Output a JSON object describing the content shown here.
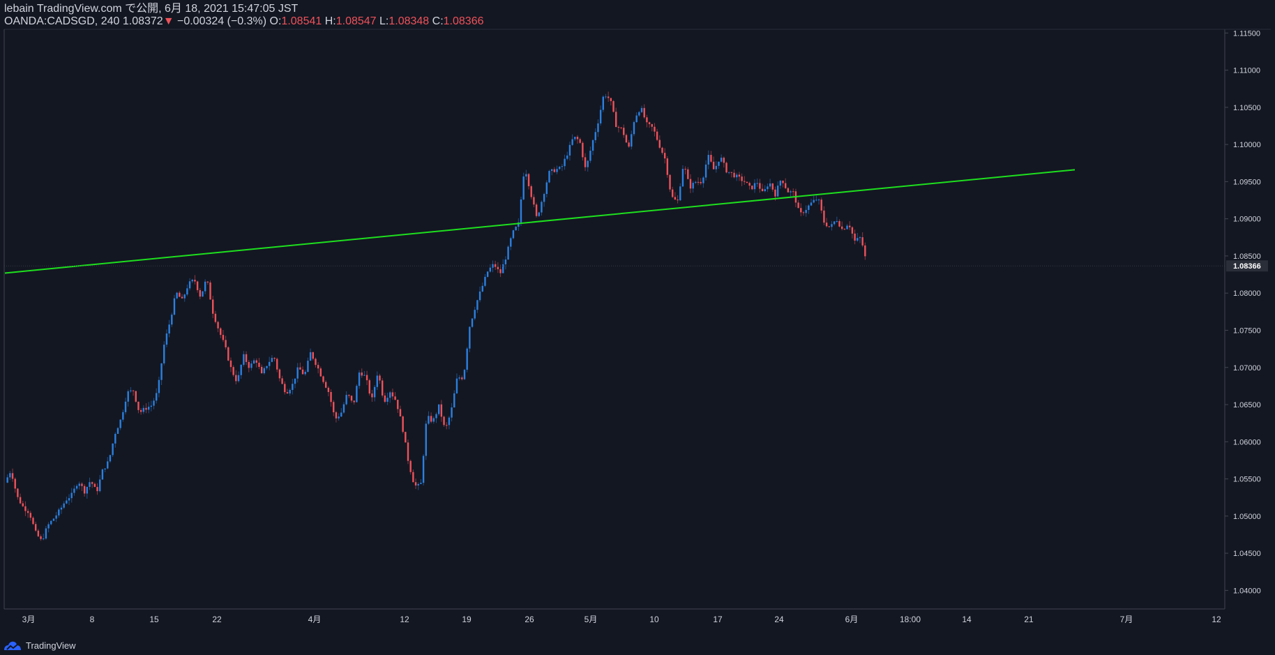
{
  "header": {
    "published_line": "lebain TradingView.com で公開, 6月 18, 2021 15:47:05 JST",
    "symbol": "OANDA:CADSGD, 240",
    "last": "1.08372",
    "change_arrow": "▼",
    "change": "−0.00324 (−0.3%)",
    "o_label": "O:",
    "o_value": "1.08541",
    "h_label": "H:",
    "h_value": "1.08547",
    "l_label": "L:",
    "l_value": "1.08348",
    "c_label": "C:",
    "c_value": "1.08366"
  },
  "footer": {
    "brand": "TradingView"
  },
  "colors": {
    "background": "#131722",
    "up": "#2b80e0",
    "down": "#f0525a",
    "trendline": "#1ee01e",
    "axis_text": "#d1d4dc"
  },
  "chart_data": {
    "type": "candlestick",
    "symbol": "OANDA:CADSGD",
    "timeframe": "240",
    "ylim": [
      1.0375,
      1.1155
    ],
    "y_ticks": [
      "1.11500",
      "1.11000",
      "1.10500",
      "1.10000",
      "1.09500",
      "1.09000",
      "1.08500",
      "1.08000",
      "1.07500",
      "1.07000",
      "1.06500",
      "1.06000",
      "1.05500",
      "1.05000",
      "1.04500",
      "1.04000"
    ],
    "x_ticks": [
      "3月",
      "8",
      "15",
      "22",
      "4月",
      "12",
      "19",
      "26",
      "5月",
      "10",
      "17",
      "24",
      "6月",
      "18:00",
      "14",
      "21",
      "7月",
      "12"
    ],
    "last_price_label": "1.08366",
    "trendline": {
      "start": [
        0,
        1.0827
      ],
      "end": [
        175,
        1.0966
      ]
    },
    "path_points": [
      [
        0,
        1.0545
      ],
      [
        1,
        1.0562
      ],
      [
        2,
        1.0526
      ],
      [
        3,
        1.0512
      ],
      [
        4,
        1.0505
      ],
      [
        5,
        1.0478
      ],
      [
        6,
        1.0466
      ],
      [
        7,
        1.0487
      ],
      [
        8,
        1.0497
      ],
      [
        9,
        1.0508
      ],
      [
        10,
        1.0522
      ],
      [
        11,
        1.0529
      ],
      [
        12,
        1.0548
      ],
      [
        13,
        1.0533
      ],
      [
        14,
        1.0548
      ],
      [
        15,
        1.0532
      ],
      [
        16,
        1.0562
      ],
      [
        17,
        1.0574
      ],
      [
        18,
        1.0611
      ],
      [
        19,
        1.0631
      ],
      [
        20,
        1.0666
      ],
      [
        21,
        1.0669
      ],
      [
        22,
        1.0639
      ],
      [
        23,
        1.0645
      ],
      [
        24,
        1.0649
      ],
      [
        25,
        1.0668
      ],
      [
        26,
        1.0729
      ],
      [
        27,
        1.0762
      ],
      [
        28,
        1.0801
      ],
      [
        29,
        1.079
      ],
      [
        30,
        1.0812
      ],
      [
        31,
        1.0818
      ],
      [
        32,
        1.0795
      ],
      [
        33,
        1.082
      ],
      [
        34,
        1.0775
      ],
      [
        35,
        1.075
      ],
      [
        36,
        1.0728
      ],
      [
        37,
        1.0698
      ],
      [
        38,
        1.068
      ],
      [
        39,
        1.0716
      ],
      [
        40,
        1.07
      ],
      [
        41,
        1.0712
      ],
      [
        42,
        1.069
      ],
      [
        43,
        1.0706
      ],
      [
        44,
        1.0715
      ],
      [
        45,
        1.0683
      ],
      [
        46,
        1.0666
      ],
      [
        47,
        1.0676
      ],
      [
        48,
        1.07
      ],
      [
        49,
        1.0689
      ],
      [
        50,
        1.072
      ],
      [
        51,
        1.0703
      ],
      [
        52,
        1.0684
      ],
      [
        53,
        1.0666
      ],
      [
        54,
        1.063
      ],
      [
        55,
        1.0639
      ],
      [
        56,
        1.0665
      ],
      [
        57,
        1.0649
      ],
      [
        58,
        1.0695
      ],
      [
        59,
        1.0687
      ],
      [
        60,
        1.0655
      ],
      [
        61,
        1.0695
      ],
      [
        62,
        1.0654
      ],
      [
        63,
        1.0668
      ],
      [
        64,
        1.0655
      ],
      [
        65,
        1.0621
      ],
      [
        66,
        1.0573
      ],
      [
        67,
        1.0541
      ],
      [
        68,
        1.054
      ],
      [
        69,
        1.0634
      ],
      [
        70,
        1.0627
      ],
      [
        71,
        1.0648
      ],
      [
        72,
        1.0615
      ],
      [
        73,
        1.0641
      ],
      [
        74,
        1.0687
      ],
      [
        75,
        1.0686
      ],
      [
        76,
        1.0755
      ],
      [
        77,
        1.0784
      ],
      [
        78,
        1.0807
      ],
      [
        79,
        1.083
      ],
      [
        80,
        1.0839
      ],
      [
        81,
        1.0826
      ],
      [
        82,
        1.085
      ],
      [
        83,
        1.088
      ],
      [
        84,
        1.0893
      ],
      [
        85,
        1.0972
      ],
      [
        86,
        1.0935
      ],
      [
        87,
        1.09
      ],
      [
        88,
        1.093
      ],
      [
        89,
        1.0962
      ],
      [
        90,
        1.0966
      ],
      [
        91,
        1.0968
      ],
      [
        92,
        1.0988
      ],
      [
        93,
        1.101
      ],
      [
        94,
        1.1005
      ],
      [
        95,
        1.0965
      ],
      [
        96,
        1.1
      ],
      [
        97,
        1.103
      ],
      [
        98,
        1.1069
      ],
      [
        99,
        1.106
      ],
      [
        100,
        1.1025
      ],
      [
        101,
        1.102
      ],
      [
        102,
        1.0993
      ],
      [
        103,
        1.1036
      ],
      [
        104,
        1.105
      ],
      [
        105,
        1.1027
      ],
      [
        106,
        1.1022
      ],
      [
        107,
        1.1
      ],
      [
        108,
        1.098
      ],
      [
        109,
        1.093
      ],
      [
        110,
        1.0922
      ],
      [
        111,
        1.0975
      ],
      [
        112,
        1.0942
      ],
      [
        113,
        1.095
      ],
      [
        114,
        1.095
      ],
      [
        115,
        1.0985
      ],
      [
        116,
        1.0965
      ],
      [
        117,
        1.0984
      ],
      [
        118,
        1.0965
      ],
      [
        119,
        1.096
      ],
      [
        120,
        1.0955
      ],
      [
        121,
        1.095
      ],
      [
        122,
        1.094
      ],
      [
        123,
        1.095
      ],
      [
        124,
        1.0933
      ],
      [
        125,
        1.095
      ],
      [
        126,
        1.0933
      ],
      [
        127,
        1.0955
      ],
      [
        128,
        1.0937
      ],
      [
        129,
        1.0935
      ],
      [
        130,
        1.0905
      ],
      [
        131,
        1.0913
      ],
      [
        132,
        1.0922
      ],
      [
        133,
        1.0928
      ],
      [
        134,
        1.0895
      ],
      [
        135,
        1.0888
      ],
      [
        136,
        1.09
      ],
      [
        137,
        1.0885
      ],
      [
        138,
        1.0895
      ],
      [
        139,
        1.087
      ],
      [
        140,
        1.0875
      ],
      [
        141,
        1.0837
      ]
    ]
  }
}
